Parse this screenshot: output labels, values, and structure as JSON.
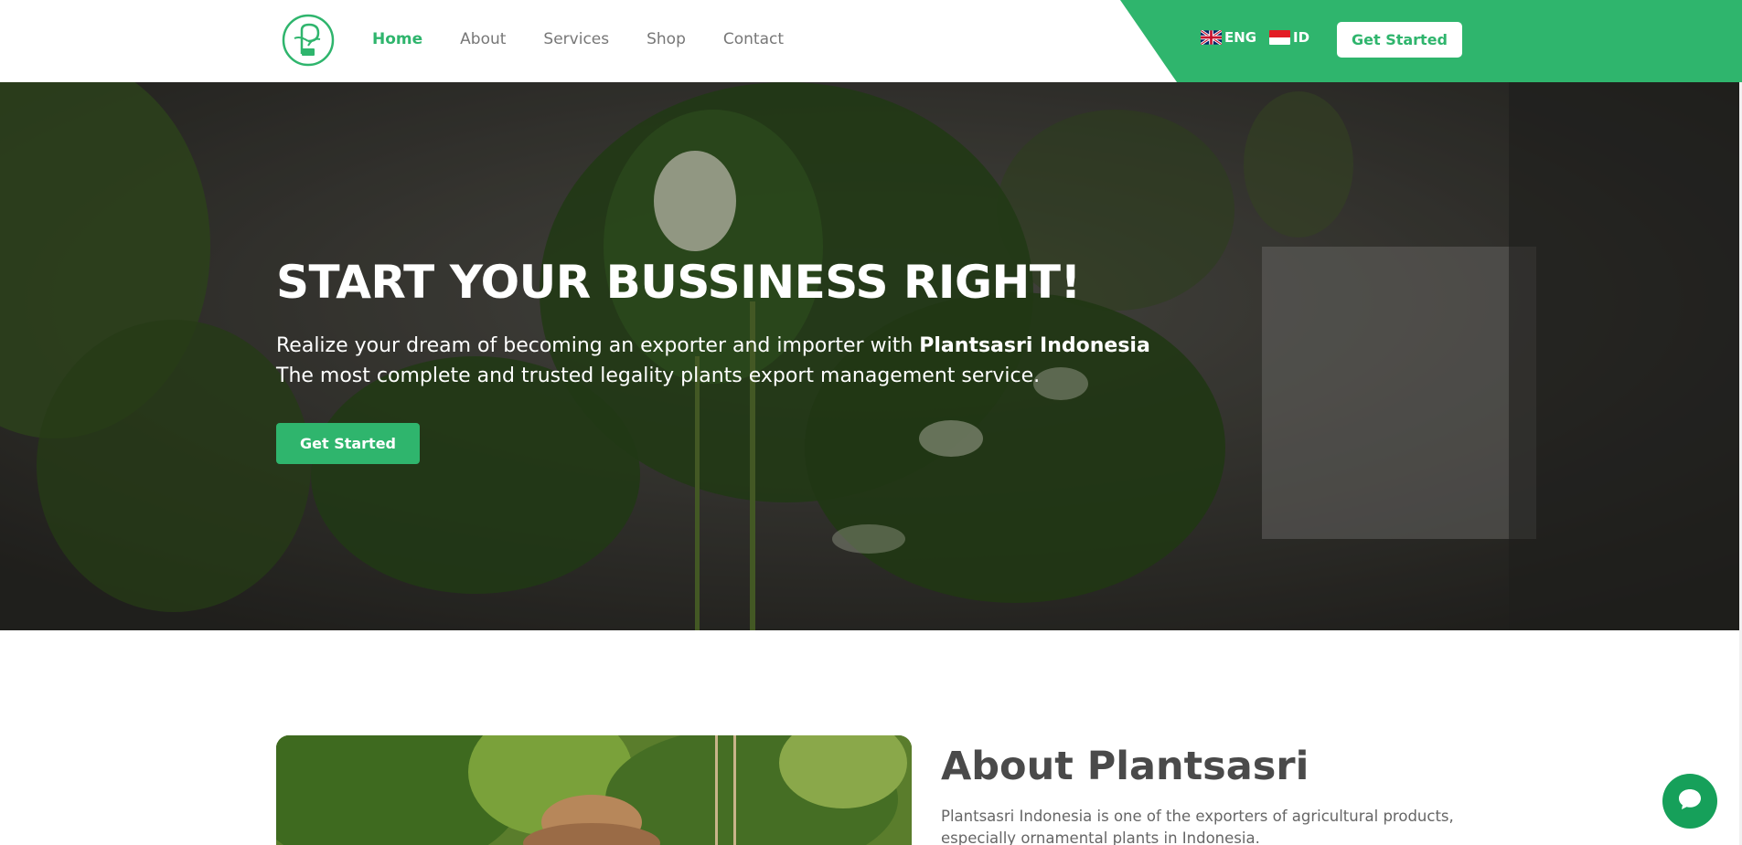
{
  "header": {
    "nav": [
      {
        "label": "Home",
        "active": true
      },
      {
        "label": "About",
        "active": false
      },
      {
        "label": "Services",
        "active": false
      },
      {
        "label": "Shop",
        "active": false
      },
      {
        "label": "Contact",
        "active": false
      }
    ],
    "languages": [
      {
        "code": "ENG",
        "flag": "uk-flag-icon"
      },
      {
        "code": "ID",
        "flag": "indonesia-flag-icon"
      }
    ],
    "cta_label": "Get Started"
  },
  "hero": {
    "title": "START YOUR BUSSINESS RIGHT!",
    "line1_prefix": "Realize your dream of becoming an exporter and importer with ",
    "line1_brand": "Plantsasri Indonesia",
    "line2": "The most complete and trusted legality plants export management service.",
    "cta_label": "Get Started"
  },
  "about": {
    "title": "About Plantsasri",
    "description": "Plantsasri Indonesia is one of the exporters of agricultural products, especially ornamental plants in Indonesia."
  },
  "colors": {
    "accent": "#2fb56d",
    "chat": "#16a05a"
  }
}
